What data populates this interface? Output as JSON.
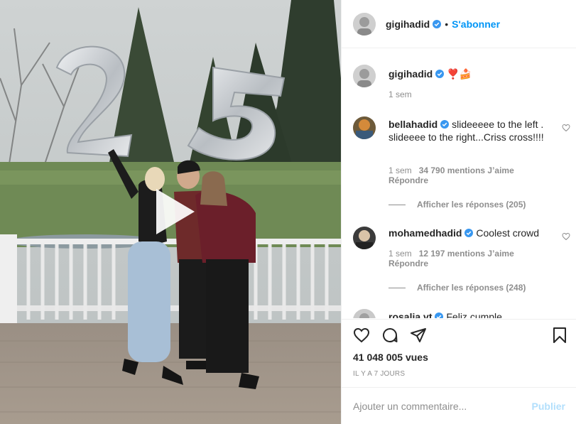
{
  "post": {
    "author": "gigihadid",
    "dot": "•",
    "follow_label": "S'abonner",
    "caption_emoji": "❣️🍰",
    "caption_age": "1 sem",
    "views": "41 048 005 vues",
    "age": "Il y a 7 jours"
  },
  "comments": [
    {
      "user": "bellahadid",
      "text": "slideeeee to the left . slideeee to the right...Criss cross!!!!",
      "age": "1 sem",
      "likes": "34 790 mentions J’aime",
      "reply": "Répondre",
      "view_replies": "Afficher les réponses (205)"
    },
    {
      "user": "mohamedhadid",
      "text": "Coolest crowd",
      "age": "1 sem",
      "likes": "12 197 mentions J’aime",
      "reply": "Répondre",
      "view_replies": "Afficher les réponses (248)"
    },
    {
      "user": "rosalia.vt",
      "text": "Feliz cumple"
    }
  ],
  "composer": {
    "placeholder": "Ajouter un commentaire...",
    "publish_label": "Publier"
  },
  "icons": {
    "like": "heart-icon",
    "comment": "comment-icon",
    "share": "paper-plane-icon",
    "save": "bookmark-icon",
    "play": "play-icon",
    "verified": "verified-badge-icon"
  },
  "colors": {
    "link_blue": "#0095f6",
    "publish_disabled": "#b2dffc",
    "verified_blue": "#3897f0",
    "muted_text": "#8e8e8e"
  }
}
